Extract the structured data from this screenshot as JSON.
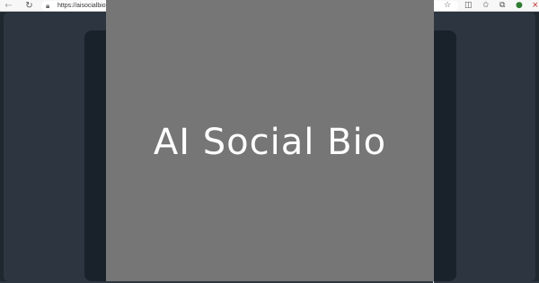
{
  "browser": {
    "url": "https://aisocialbio.c",
    "icons": {
      "back": "back-arrow-icon",
      "reload": "reload-icon",
      "lock": "lock-icon",
      "star": "favorite-star-icon",
      "split": "split-screen-icon",
      "favorites": "favorites-icon",
      "collections": "collections-icon",
      "extension": "extension-icon",
      "close": "close-icon"
    }
  },
  "splash": {
    "title": "AI Social Bio",
    "background": "#767676",
    "text_color": "#ffffff"
  },
  "colors": {
    "page_bg": "#2d3640",
    "card_bg": "#19212a"
  }
}
